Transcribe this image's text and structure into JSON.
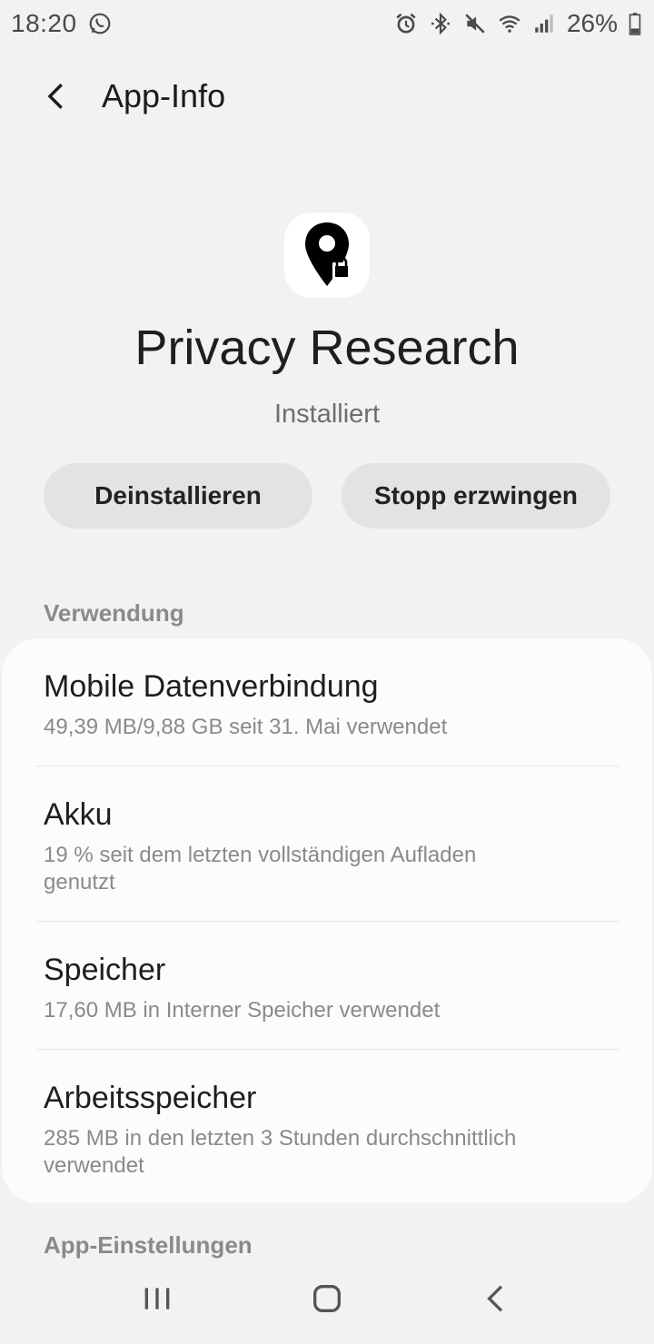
{
  "status_bar": {
    "time": "18:20",
    "battery_percent": "26%",
    "icons": [
      "whatsapp-icon",
      "alarm-icon",
      "bluetooth-icon",
      "mute-icon",
      "wifi-icon",
      "signal-icon",
      "battery-icon"
    ]
  },
  "header": {
    "title": "App-Info",
    "back_icon": "back-arrow-icon"
  },
  "app": {
    "name": "Privacy Research",
    "status": "Installiert",
    "icon": "location-pin-lock-icon"
  },
  "actions": {
    "uninstall_label": "Deinstallieren",
    "force_stop_label": "Stopp erzwingen"
  },
  "usage": {
    "section_label": "Verwendung",
    "items": [
      {
        "title": "Mobile Datenverbindung",
        "subtitle": "49,39 MB/9,88 GB seit 31. Mai verwendet"
      },
      {
        "title": "Akku",
        "subtitle": "19 % seit dem letzten vollständigen Aufladen genutzt"
      },
      {
        "title": "Speicher",
        "subtitle": "17,60 MB in Interner Speicher verwendet"
      },
      {
        "title": "Arbeitsspeicher",
        "subtitle": "285 MB in den letzten 3 Stunden durchschnittlich verwendet"
      }
    ]
  },
  "app_settings": {
    "section_label": "App-Einstellungen"
  },
  "navbar": {
    "buttons": [
      "recents-icon",
      "home-icon",
      "back-icon"
    ]
  },
  "colors": {
    "background": "#f2f2f2",
    "card": "#fcfcfc",
    "pill": "#e3e3e3",
    "secondary_text": "#8a8a8a"
  }
}
